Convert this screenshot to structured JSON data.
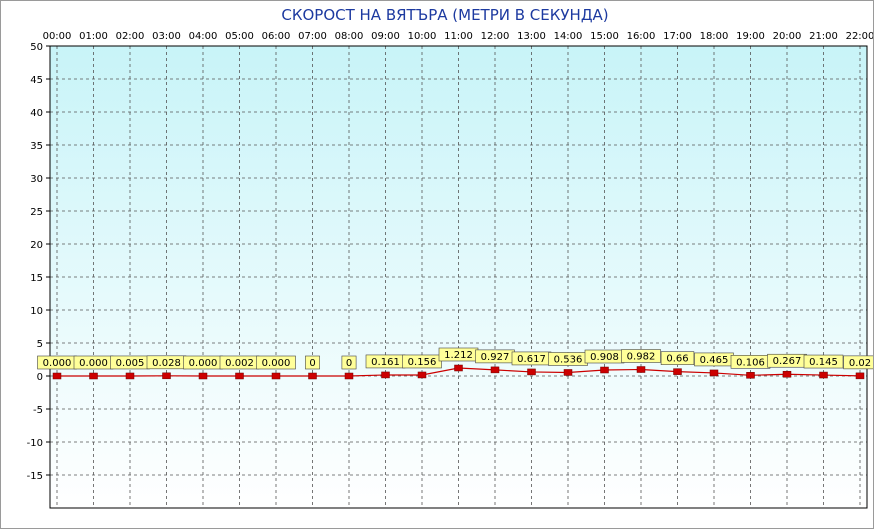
{
  "chart_data": {
    "type": "line",
    "title": "СКОРОСТ НА ВЯТЪРА (МЕТРИ В СЕКУНДА)",
    "xlabel": "",
    "ylabel": "",
    "categories": [
      "00:00",
      "01:00",
      "02:00",
      "03:00",
      "04:00",
      "05:00",
      "06:00",
      "07:00",
      "08:00",
      "09:00",
      "10:00",
      "11:00",
      "12:00",
      "13:00",
      "14:00",
      "15:00",
      "16:00",
      "17:00",
      "18:00",
      "19:00",
      "20:00",
      "21:00",
      "22:00"
    ],
    "series": [
      {
        "values": [
          0.0,
          0.0,
          0.005,
          0.028,
          0.0,
          0.002,
          0.0,
          0,
          0,
          0.161,
          0.156,
          1.212,
          0.927,
          0.617,
          0.536,
          0.908,
          0.982,
          0.66,
          0.465,
          0.106,
          0.267,
          0.145,
          0.02
        ],
        "labels": [
          "0.000",
          "0.000",
          "0.005",
          "0.028",
          "0.000",
          "0.002",
          "0.000",
          "0",
          "0",
          "0.161",
          "0.156",
          "1.212",
          "0.927",
          "0.617",
          "0.536",
          "0.908",
          "0.982",
          "0.66",
          "0.465",
          "0.106",
          "0.267",
          "0.145",
          "0.02"
        ],
        "color": "#cc0000"
      }
    ],
    "yticks": [
      50,
      45,
      40,
      35,
      30,
      25,
      20,
      15,
      10,
      5,
      0,
      -5,
      -10,
      -15
    ],
    "ylim": [
      -20,
      50
    ],
    "grid": true,
    "legend": "none"
  },
  "colors": {
    "bg_top": "#c8f4f8",
    "bg_bottom": "#ffffff",
    "grid": "#555555",
    "label_bg": "#ffff99",
    "marker": "#cc0000",
    "title": "#1d3aa0"
  }
}
